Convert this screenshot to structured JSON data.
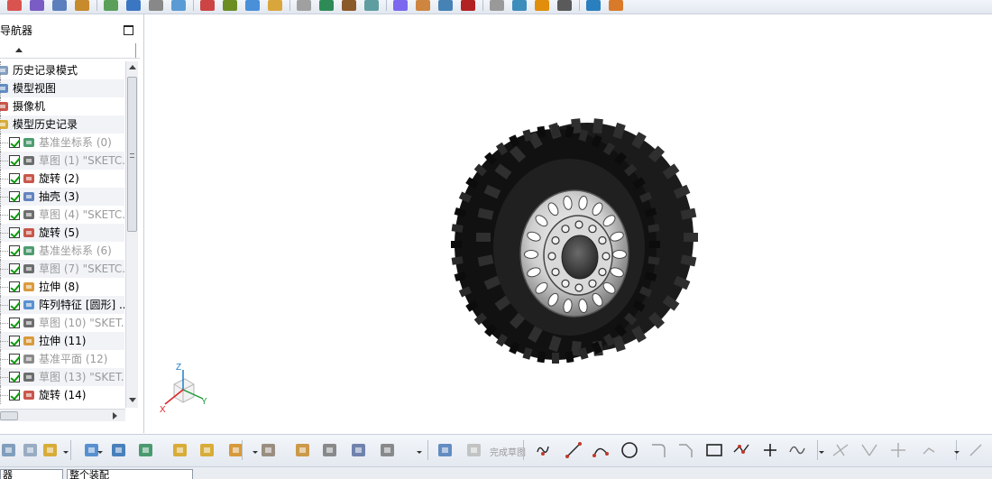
{
  "navigator": {
    "title": "部件导航器",
    "title_visible": "导航器",
    "tree": [
      {
        "label": "历史记录模式",
        "icon": "history-mode-icon",
        "dim": false,
        "checkbox": false
      },
      {
        "label": "模型视图",
        "icon": "model-views-icon",
        "dim": false,
        "checkbox": false
      },
      {
        "label": "摄像机",
        "icon": "camera-icon",
        "dim": false,
        "checkbox": false
      },
      {
        "label": "模型历史记录",
        "icon": "model-history-folder-icon",
        "dim": false,
        "checkbox": false
      },
      {
        "label": "基准坐标系 (0)",
        "icon": "datum-csys-icon",
        "dim": true,
        "checkbox": true
      },
      {
        "label": "草图 (1) \"SKETC...",
        "icon": "sketch-icon",
        "dim": true,
        "checkbox": true
      },
      {
        "label": "旋转 (2)",
        "icon": "revolve-icon",
        "dim": false,
        "checkbox": true
      },
      {
        "label": "抽壳 (3)",
        "icon": "shell-icon",
        "dim": false,
        "checkbox": true
      },
      {
        "label": "草图 (4) \"SKETC...",
        "icon": "sketch-icon",
        "dim": true,
        "checkbox": true
      },
      {
        "label": "旋转 (5)",
        "icon": "revolve-icon",
        "dim": false,
        "checkbox": true
      },
      {
        "label": "基准坐标系 (6)",
        "icon": "datum-csys-icon",
        "dim": true,
        "checkbox": true
      },
      {
        "label": "草图 (7) \"SKETC...",
        "icon": "sketch-icon",
        "dim": true,
        "checkbox": true
      },
      {
        "label": "拉伸 (8)",
        "icon": "extrude-icon",
        "dim": false,
        "checkbox": true
      },
      {
        "label": "阵列特征 [圆形] ...",
        "icon": "pattern-feature-icon",
        "dim": false,
        "checkbox": true
      },
      {
        "label": "草图 (10) \"SKET...",
        "icon": "sketch-icon",
        "dim": true,
        "checkbox": true
      },
      {
        "label": "拉伸 (11)",
        "icon": "extrude-icon",
        "dim": false,
        "checkbox": true
      },
      {
        "label": "基准平面 (12)",
        "icon": "datum-plane-icon",
        "dim": true,
        "checkbox": true
      },
      {
        "label": "草图 (13) \"SKET...",
        "icon": "sketch-icon",
        "dim": true,
        "checkbox": true
      },
      {
        "label": "旋转 (14)",
        "icon": "revolve-icon",
        "dim": false,
        "checkbox": true
      }
    ]
  },
  "viewport": {
    "model": "tire-wheel-model",
    "triad": {
      "z": "Z",
      "y": "Y",
      "x": "X"
    }
  },
  "sketch_toolbar": {
    "finish_sketch_label": "完成草图"
  },
  "status_bar": {
    "selection_filter": "器",
    "assembly_scope": "整个装配"
  },
  "colors": {
    "check_green": "#0a9a0a",
    "dim_text": "#9a9a9a",
    "tire": "#161616",
    "rim": "#c8c8c8"
  }
}
